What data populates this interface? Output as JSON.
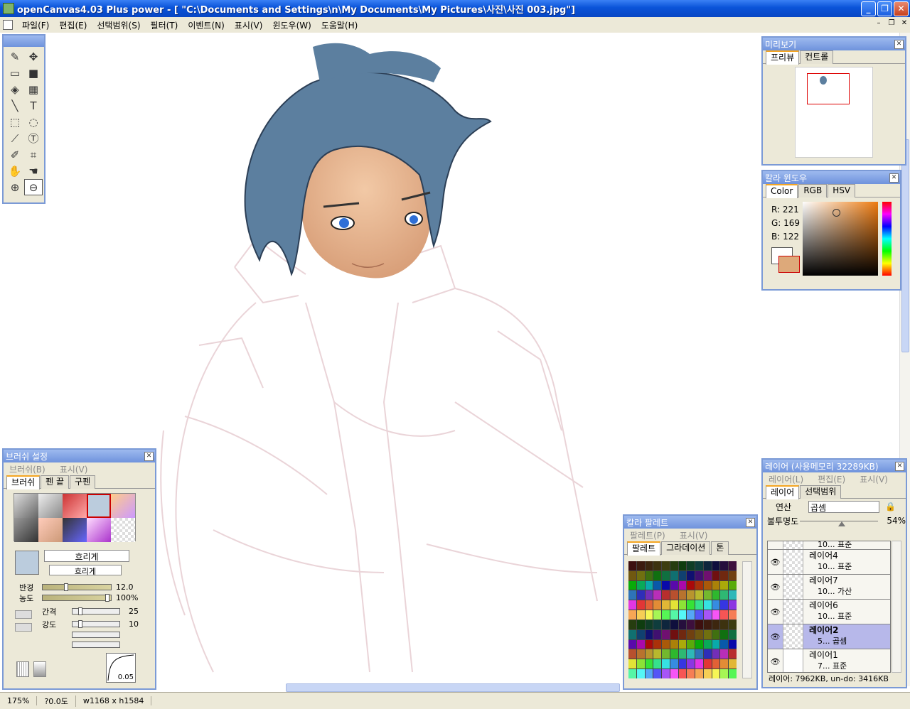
{
  "window": {
    "title": "openCanvas4.03 Plus power - [ \"C:\\Documents and Settings\\n\\My Documents\\My Pictures\\사진\\사진 003.jpg\"]",
    "minimize": "_",
    "maximize": "❐",
    "close": "✕"
  },
  "menu": [
    "파일(F)",
    "편집(E)",
    "선택범위(S)",
    "필터(T)",
    "이벤트(N)",
    "표시(V)",
    "윈도우(W)",
    "도움말(H)"
  ],
  "mdi_buttons": [
    "–",
    "❐",
    "✕"
  ],
  "preview": {
    "title": "미리보기",
    "tabs": [
      "프리뷰",
      "컨트롤"
    ]
  },
  "color_window": {
    "title": "칼라 윈도우",
    "tabs": [
      "Color",
      "RGB",
      "HSV"
    ],
    "r_label": "R: 221",
    "g_label": "G: 169",
    "b_label": "B: 122",
    "current_color": "#dda97a"
  },
  "brush": {
    "title": "브러쉬 설정",
    "menu": [
      "브러쉬(B)",
      "표시(V)"
    ],
    "tabs": [
      "브러쉬",
      "펜 끝",
      "구펜"
    ],
    "name1": "흐리게",
    "name2": "흐리게",
    "radius_label": "반경",
    "radius_value": "12.0",
    "density_label": "농도",
    "density_value": "100%",
    "spacing_label": "간격",
    "spacing_value": "25",
    "strength_label": "강도",
    "strength_value": "10",
    "curve_value": "0.05"
  },
  "palette": {
    "title": "칼라 팔레트",
    "menu": [
      "팔레트(P)",
      "표시(V)"
    ],
    "tabs": [
      "팔레트",
      "그라데이션",
      "톤"
    ]
  },
  "layers": {
    "title": "레이어 (사용메모리 32289KB)",
    "menu": [
      "레이어(L)",
      "편집(E)",
      "표시(V)"
    ],
    "tabs": [
      "레이어",
      "선택범위"
    ],
    "blend_label": "연산",
    "blend_value": "곱셈",
    "opacity_label": "불투명도",
    "opacity_value": "54%",
    "opacity_fraction": 0.54,
    "partial_row": "10... 표준",
    "items": [
      {
        "name": "레이어4",
        "sub": "10... 표준"
      },
      {
        "name": "레이어7",
        "sub": "10... 가산"
      },
      {
        "name": "레이어6",
        "sub": "10... 표준"
      },
      {
        "name": "레이어2",
        "sub": "5... 곱셈"
      },
      {
        "name": "레이어1",
        "sub": "7... 표준"
      }
    ],
    "footer": "레이어: 7962KB, un-do: 3416KB"
  },
  "status": {
    "zoom": "175%",
    "angle": "?0.0도",
    "size": "w1168 x h1584"
  }
}
